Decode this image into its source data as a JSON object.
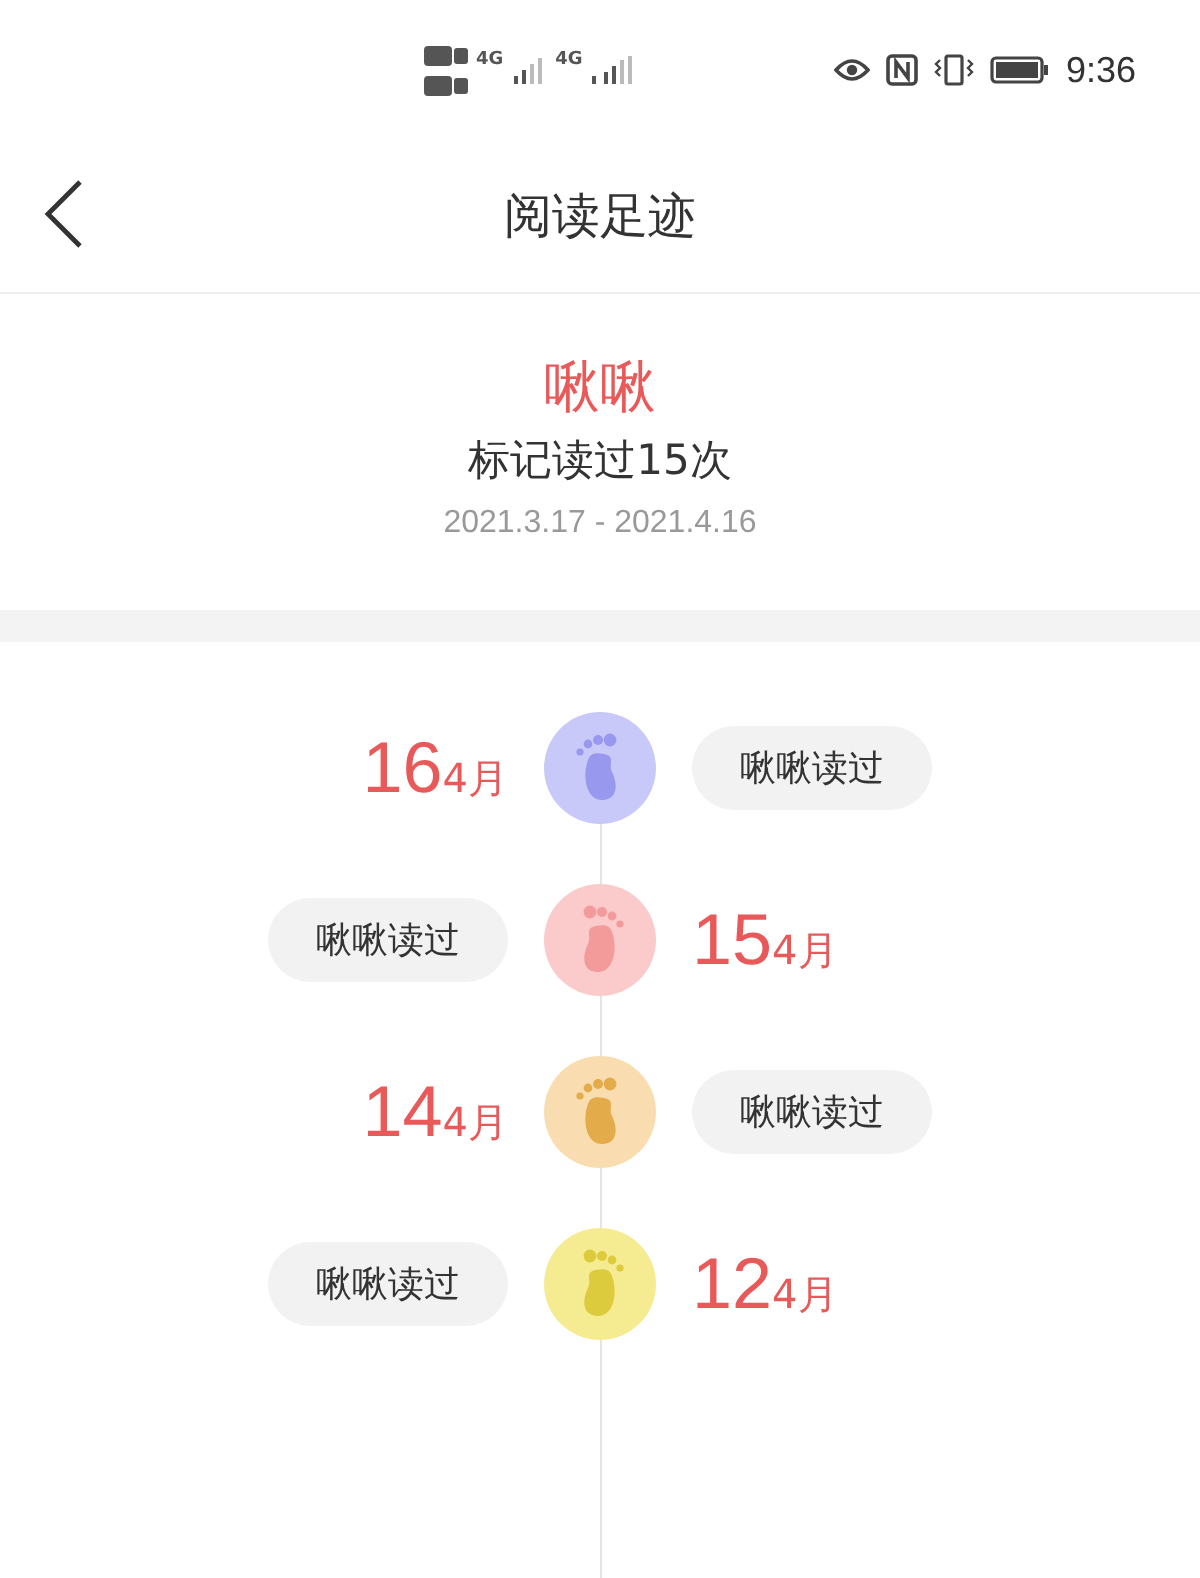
{
  "status_bar": {
    "sim1_network": "4G",
    "sim2_network": "4G",
    "time": "9:36"
  },
  "header": {
    "title": "阅读足迹"
  },
  "summary": {
    "name": "啾啾",
    "count_text": "标记读过15次",
    "date_range": "2021.3.17 - 2021.4.16"
  },
  "entries": [
    {
      "day": "16",
      "month": "4月",
      "label": "啾啾读过",
      "kind": "date-first",
      "color": "#c9c9f9"
    },
    {
      "day": "15",
      "month": "4月",
      "label": "啾啾读过",
      "kind": "tag-first",
      "color": "#fbcaca"
    },
    {
      "day": "14",
      "month": "4月",
      "label": "啾啾读过",
      "kind": "date-first",
      "color": "#f9ddb0"
    },
    {
      "day": "12",
      "month": "4月",
      "label": "啾啾读过",
      "kind": "tag-first",
      "color": "#f5ec92"
    }
  ]
}
